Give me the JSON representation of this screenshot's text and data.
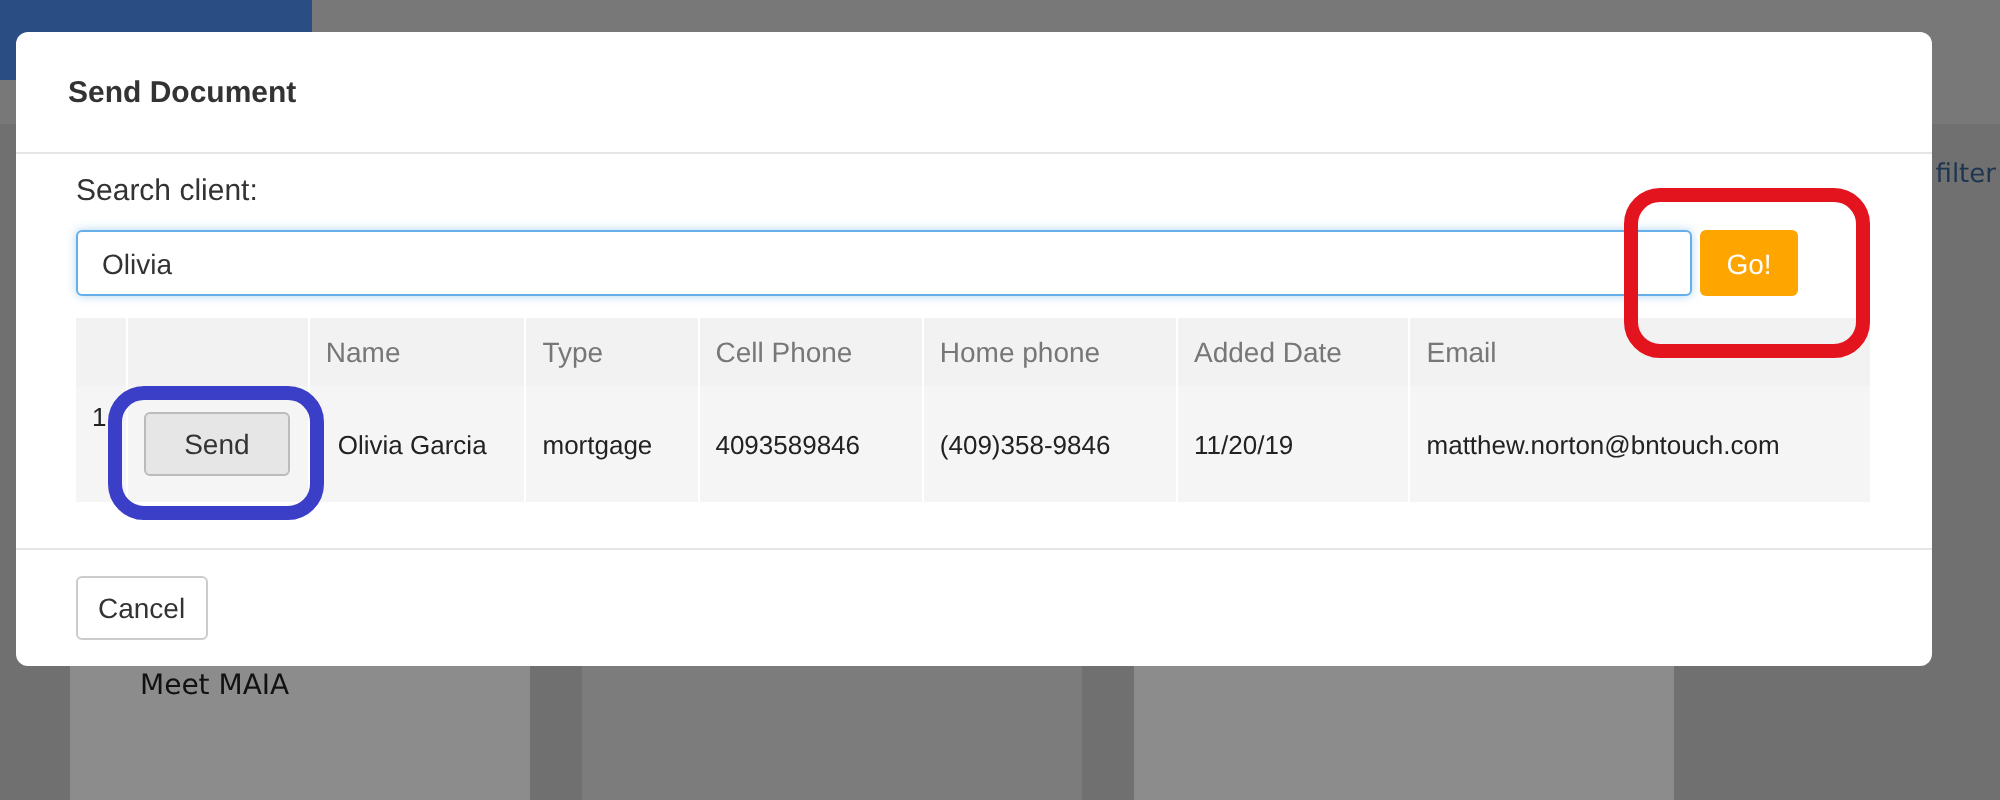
{
  "background": {
    "filter_link": "filter",
    "card_heading": "Meet MAIA"
  },
  "modal": {
    "title": "Send Document",
    "search_label": "Search client:",
    "search_value": "Olivia",
    "go_button": "Go!",
    "table": {
      "columns": [
        "",
        "",
        "Name",
        "Type",
        "Cell Phone",
        "Home phone",
        "Added Date",
        "Email"
      ],
      "rows": [
        {
          "index": "1",
          "action": "Send",
          "name": "Olivia Garcia",
          "type": "mortgage",
          "cell_phone": "4093589846",
          "home_phone": "(409)358-9846",
          "added_date": "11/20/19",
          "email": "matthew.norton@bntouch.com"
        }
      ]
    },
    "cancel_button": "Cancel"
  },
  "annotations": [
    {
      "color": "#e3141e"
    },
    {
      "color": "#3b3fc8"
    }
  ]
}
